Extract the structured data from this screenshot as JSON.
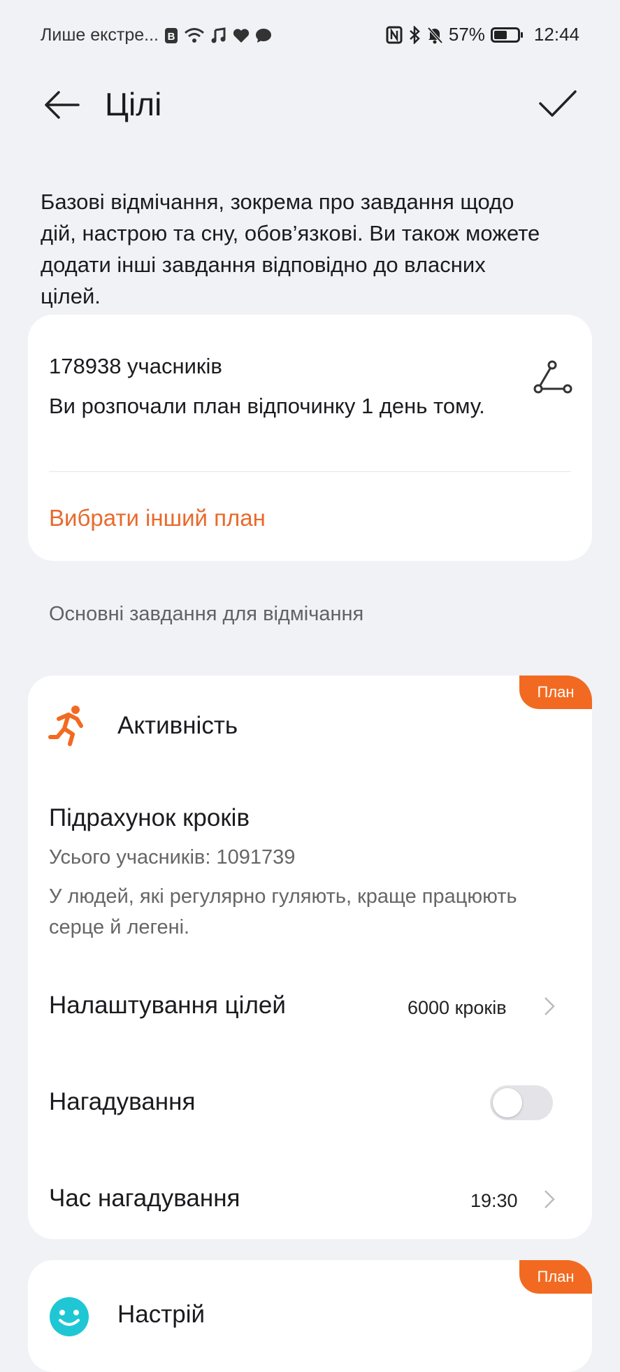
{
  "status_bar": {
    "carrier": "Лише екстре...",
    "battery_percent": "57%",
    "battery_level": 0.57,
    "time": "12:44"
  },
  "header": {
    "title": "Цілі",
    "back_icon": "arrow-left-icon",
    "confirm_icon": "check-icon"
  },
  "intro_text": "Базові відмічання, зокрема про завдання щодо дій, настрою та сну, обов’язкові. Ви також можете додати інші завдання відповідно до власних цілей.",
  "plan_card": {
    "participants": "178938 учасників",
    "description": "Ви розпочали план відпочинку 1 день тому.",
    "action": "Вибрати інший план",
    "share_icon": "share-icon"
  },
  "section_title": "Основні завдання для відмічання",
  "activity_card": {
    "badge": "План",
    "title": "Активність",
    "icon": "running-icon",
    "task_title": "Підрахунок кроків",
    "task_participants": "Усього учасників: 1091739",
    "task_description": "У людей, які регулярно гуляють, краще працюють серце й легені.",
    "goal_label": "Налаштування цілей",
    "goal_value": "6000 кроків",
    "reminder_label": "Нагадування",
    "reminder_on": false,
    "reminder_time_label": "Час нагадування",
    "reminder_time_value": "19:30"
  },
  "mood_card": {
    "badge": "План",
    "title": "Настрій",
    "icon": "smiley-icon"
  },
  "colors": {
    "accent": "#f26a21",
    "action_text": "#e86a2b",
    "mood_icon": "#1fc7d4",
    "background": "#f1f2f6"
  }
}
